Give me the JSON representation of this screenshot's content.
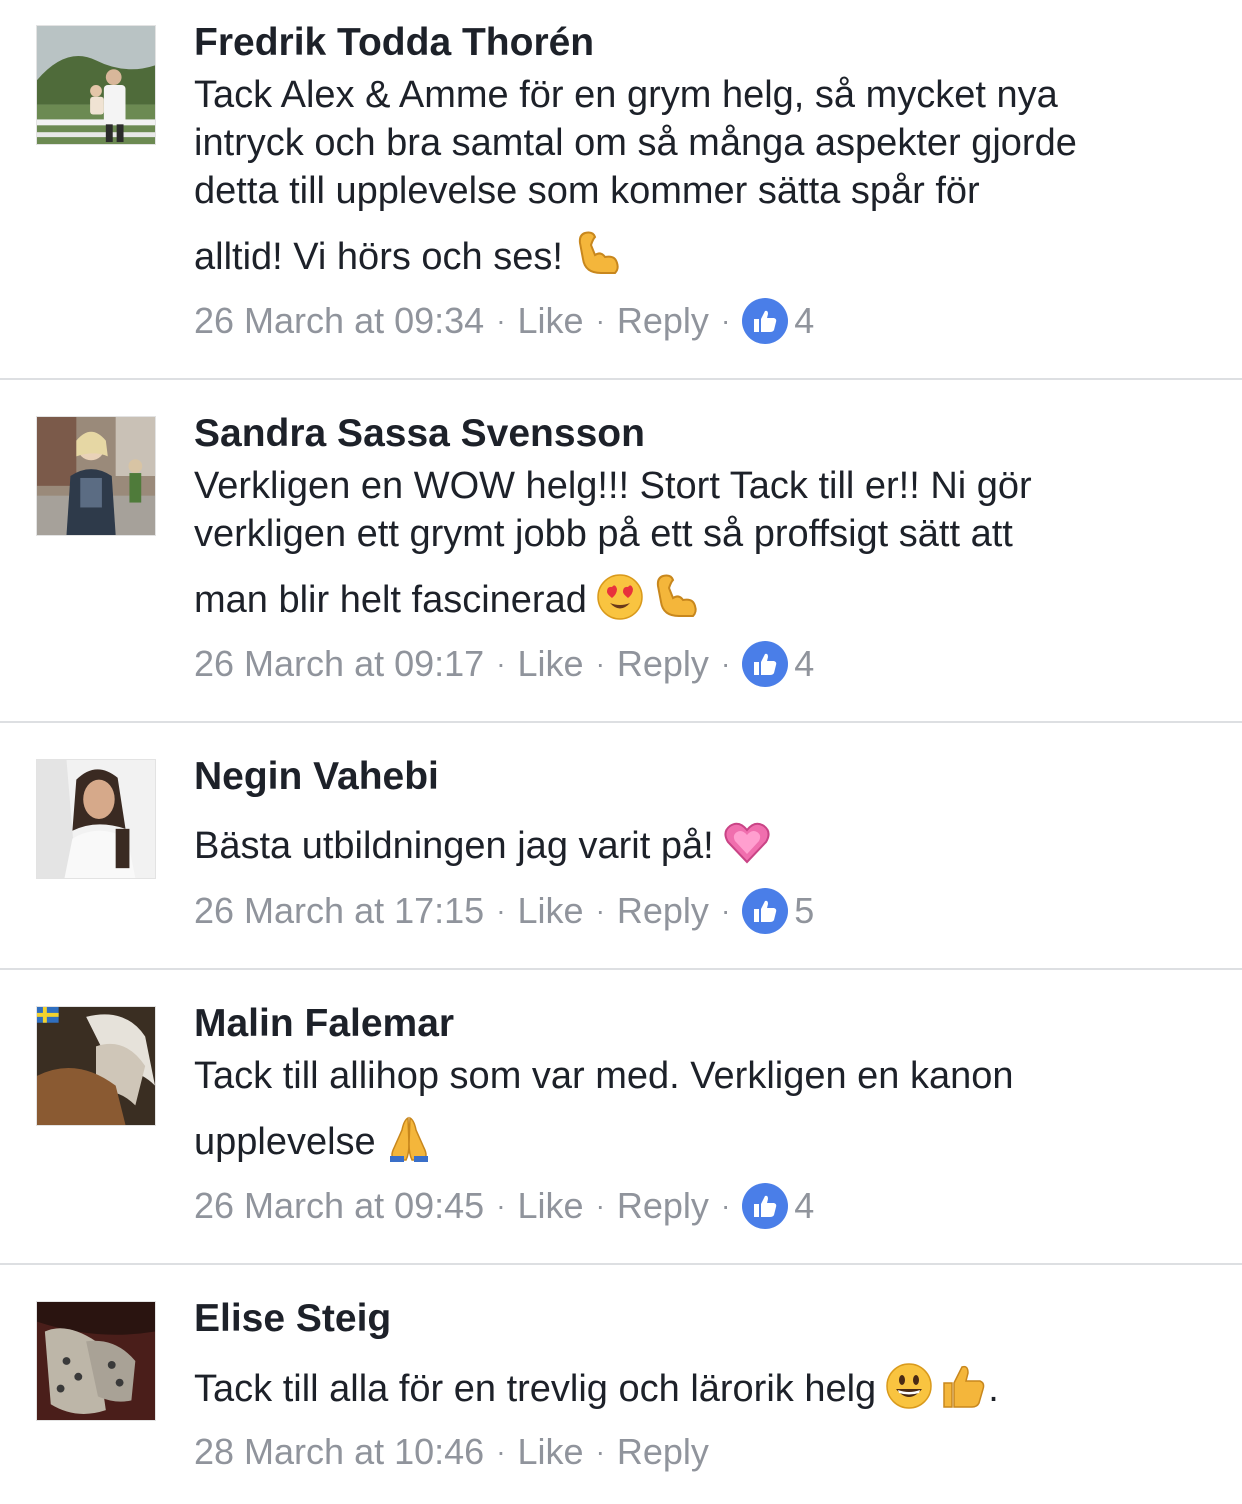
{
  "comments": [
    {
      "author": "Fredrik Todda Thorén",
      "lines": [
        "Tack Alex & Amme för en grym helg, så mycket nya",
        "intryck och bra samtal om så många aspekter gjorde",
        "detta till upplevelse som kommer sätta spår för",
        "alltid! Vi hörs och ses!"
      ],
      "emojis": [
        "flexed-biceps"
      ],
      "timestamp": "26 March at 09:34",
      "like_label": "Like",
      "reply_label": "Reply",
      "separator": "·",
      "reaction_count": "4"
    },
    {
      "author": "Sandra Sassa Svensson",
      "lines": [
        "Verkligen en WOW helg!!! Stort Tack till er!! Ni gör",
        "verkligen ett grymt jobb på ett så proffsigt sätt att",
        "man blir helt fascinerad"
      ],
      "emojis": [
        "heart-eyes",
        "flexed-biceps"
      ],
      "timestamp": "26 March at 09:17",
      "like_label": "Like",
      "reply_label": "Reply",
      "separator": "·",
      "reaction_count": "4"
    },
    {
      "author": "Negin Vahebi",
      "lines": [
        "Bästa utbildningen jag varit på!"
      ],
      "emojis": [
        "sparkling-heart"
      ],
      "timestamp": "26 March at 17:15",
      "like_label": "Like",
      "reply_label": "Reply",
      "separator": "·",
      "reaction_count": "5"
    },
    {
      "author": "Malin Falemar",
      "lines": [
        "Tack till allihop som var med. Verkligen en kanon",
        "upplevelse"
      ],
      "emojis": [
        "folded-hands"
      ],
      "timestamp": "26 March at 09:45",
      "like_label": "Like",
      "reply_label": "Reply",
      "separator": "·",
      "reaction_count": "4"
    },
    {
      "author": "Elise Steig",
      "lines": [
        "Tack till alla för en trevlig och lärorik helg"
      ],
      "emojis": [
        "grinning-face",
        "thumbs-up"
      ],
      "trailing_text": ".",
      "timestamp": "28 March at 10:46",
      "like_label": "Like",
      "reply_label": "Reply",
      "separator": "·"
    }
  ],
  "colors": {
    "text": "#1d2129",
    "meta": "#90949c",
    "like_badge": "#4a7ee8",
    "divider": "#dddfe2"
  }
}
